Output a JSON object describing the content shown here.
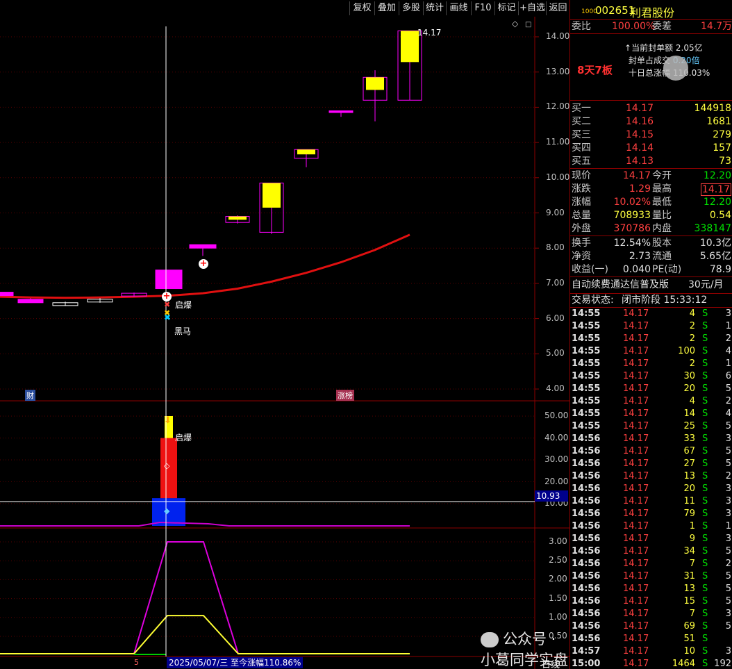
{
  "toolbar": {
    "buttons": [
      "复权",
      "叠加",
      "多股",
      "统计",
      "画线",
      "F10",
      "标记",
      "+自选",
      "返回"
    ]
  },
  "stock": {
    "code_prefix": "1000",
    "code": "002651",
    "name": "利君股份"
  },
  "weibi": {
    "label": "委比",
    "value": "100.00%",
    "diff_label": "委差",
    "diff_value": "14.7万"
  },
  "info": {
    "board": "8天7板",
    "seal_amount_label": "当前封单额",
    "seal_amount": "2.05亿",
    "seal_ratio_label": "封单占成交",
    "seal_ratio": "0.20倍",
    "ten_day_label": "十日总涨幅",
    "ten_day": "110.03%"
  },
  "bids": [
    {
      "label": "买一",
      "price": "14.17",
      "vol": "144918"
    },
    {
      "label": "买二",
      "price": "14.16",
      "vol": "1681"
    },
    {
      "label": "买三",
      "price": "14.15",
      "vol": "279"
    },
    {
      "label": "买四",
      "price": "14.14",
      "vol": "157"
    },
    {
      "label": "买五",
      "price": "14.13",
      "vol": "73"
    }
  ],
  "quote": [
    {
      "l1": "现价",
      "v1": "14.17",
      "c1": "red",
      "l2": "今开",
      "v2": "12.20",
      "c2": "green"
    },
    {
      "l1": "涨跌",
      "v1": "1.29",
      "c1": "red",
      "l2": "最高",
      "v2": "14.17",
      "c2": "red"
    },
    {
      "l1": "涨幅",
      "v1": "10.02%",
      "c1": "red",
      "l2": "最低",
      "v2": "12.20",
      "c2": "green"
    },
    {
      "l1": "总量",
      "v1": "708933",
      "c1": "yel",
      "l2": "量比",
      "v2": "0.54",
      "c2": "yel"
    },
    {
      "l1": "外盘",
      "v1": "370786",
      "c1": "red",
      "l2": "内盘",
      "v2": "338147",
      "c2": "green"
    }
  ],
  "finance": [
    {
      "l1": "换手",
      "v1": "12.54%",
      "l2": "股本",
      "v2": "10.3亿"
    },
    {
      "l1": "净资",
      "v1": "2.73",
      "l2": "流通",
      "v2": "5.65亿"
    },
    {
      "l1": "收益(一)",
      "v1": "0.040",
      "l2": "PE(动)",
      "v2": "78.9"
    }
  ],
  "promo": {
    "text": "自动续费通达信普及版",
    "price": "30元/月"
  },
  "status": {
    "label": "交易状态:",
    "value": "闭市阶段 15:33:12"
  },
  "ticks": [
    {
      "t": "14:55",
      "p": "14.17",
      "v": "4",
      "s": "S",
      "n": "3"
    },
    {
      "t": "14:55",
      "p": "14.17",
      "v": "2",
      "s": "S",
      "n": "1"
    },
    {
      "t": "14:55",
      "p": "14.17",
      "v": "2",
      "s": "S",
      "n": "2"
    },
    {
      "t": "14:55",
      "p": "14.17",
      "v": "100",
      "s": "S",
      "n": "4"
    },
    {
      "t": "14:55",
      "p": "14.17",
      "v": "2",
      "s": "S",
      "n": "1"
    },
    {
      "t": "14:55",
      "p": "14.17",
      "v": "30",
      "s": "S",
      "n": "6"
    },
    {
      "t": "14:55",
      "p": "14.17",
      "v": "20",
      "s": "S",
      "n": "5"
    },
    {
      "t": "14:55",
      "p": "14.17",
      "v": "4",
      "s": "S",
      "n": "2"
    },
    {
      "t": "14:55",
      "p": "14.17",
      "v": "14",
      "s": "S",
      "n": "4"
    },
    {
      "t": "14:55",
      "p": "14.17",
      "v": "25",
      "s": "S",
      "n": "5"
    },
    {
      "t": "14:56",
      "p": "14.17",
      "v": "33",
      "s": "S",
      "n": "3"
    },
    {
      "t": "14:56",
      "p": "14.17",
      "v": "67",
      "s": "S",
      "n": "5"
    },
    {
      "t": "14:56",
      "p": "14.17",
      "v": "27",
      "s": "S",
      "n": "5"
    },
    {
      "t": "14:56",
      "p": "14.17",
      "v": "13",
      "s": "S",
      "n": "2"
    },
    {
      "t": "14:56",
      "p": "14.17",
      "v": "20",
      "s": "S",
      "n": "3"
    },
    {
      "t": "14:56",
      "p": "14.17",
      "v": "11",
      "s": "S",
      "n": "3"
    },
    {
      "t": "14:56",
      "p": "14.17",
      "v": "79",
      "s": "S",
      "n": "3"
    },
    {
      "t": "14:56",
      "p": "14.17",
      "v": "1",
      "s": "S",
      "n": "1"
    },
    {
      "t": "14:56",
      "p": "14.17",
      "v": "9",
      "s": "S",
      "n": "3"
    },
    {
      "t": "14:56",
      "p": "14.17",
      "v": "34",
      "s": "S",
      "n": "5"
    },
    {
      "t": "14:56",
      "p": "14.17",
      "v": "7",
      "s": "S",
      "n": "2"
    },
    {
      "t": "14:56",
      "p": "14.17",
      "v": "31",
      "s": "S",
      "n": "5"
    },
    {
      "t": "14:56",
      "p": "14.17",
      "v": "13",
      "s": "S",
      "n": "5"
    },
    {
      "t": "14:56",
      "p": "14.17",
      "v": "15",
      "s": "S",
      "n": "5"
    },
    {
      "t": "14:56",
      "p": "14.17",
      "v": "7",
      "s": "S",
      "n": "3"
    },
    {
      "t": "14:56",
      "p": "14.17",
      "v": "69",
      "s": "S",
      "n": "5"
    },
    {
      "t": "14:56",
      "p": "14.17",
      "v": "51",
      "s": "S",
      "n": ""
    },
    {
      "t": "14:57",
      "p": "14.17",
      "v": "10",
      "s": "S",
      "n": "3"
    },
    {
      "t": "15:00",
      "p": "14.17",
      "v": "1464",
      "s": "S",
      "n": "192"
    }
  ],
  "watermark": {
    "text": "公众号 · 小葛同学实盘"
  },
  "chart": {
    "price_ticks": [
      "14.00",
      "13.00",
      "12.00",
      "11.00",
      "10.00",
      "9.00",
      "8.00",
      "7.00",
      "6.00",
      "5.00",
      "4.00"
    ],
    "last_price_label": "14.17",
    "signal_qibao": "启爆",
    "signal_heima": "黑马",
    "marker_cai": "财",
    "marker_zhangting": "涨榜",
    "vol_ticks": [
      "50.00",
      "40.00",
      "30.00",
      "20.00",
      "10.00"
    ],
    "vol_cursor_value": "10.93",
    "vol_signal": "启爆",
    "ind_ticks": [
      "3.00",
      "2.50",
      "2.00",
      "1.50",
      "1.00",
      "0.50"
    ],
    "bottom_left": "5",
    "bottom_info": "2025/05/07/三  至今涨幅110.86%",
    "period": "日线"
  },
  "chart_data": {
    "type": "candlestick",
    "ylim": [
      3.7,
      14.6
    ],
    "candles": [
      {
        "o": 6.75,
        "c": 6.65,
        "h": 6.75,
        "l": 6.65,
        "color": "#ff00ff",
        "fill": true
      },
      {
        "o": 6.55,
        "c": 6.45,
        "h": 6.58,
        "l": 6.45,
        "color": "#ff00ff",
        "fill": true
      },
      {
        "o": 6.45,
        "c": 6.37,
        "h": 6.48,
        "l": 6.36,
        "color": "#ffffff",
        "fill": false
      },
      {
        "o": 6.55,
        "c": 6.47,
        "h": 6.58,
        "l": 6.45,
        "color": "#ffffff",
        "fill": false
      },
      {
        "o": 6.72,
        "c": 6.64,
        "h": 6.74,
        "l": 6.62,
        "color": "#ff00ff",
        "fill": false
      },
      {
        "o": 7.38,
        "c": 6.85,
        "h": 7.38,
        "l": 6.85,
        "color": "#ff00ff",
        "fill": true
      },
      {
        "o": 8.1,
        "c": 8.0,
        "h": 8.1,
        "l": 7.78,
        "color": "#ff00ff",
        "fill": true
      },
      {
        "o": 8.9,
        "c": 8.73,
        "h": 8.93,
        "l": 8.7,
        "color": "#ff00ff",
        "fill": false,
        "body": "#ffff00"
      },
      {
        "o": 9.85,
        "c": 8.45,
        "h": 9.85,
        "l": 8.4,
        "color": "#ff00ff",
        "fill": false,
        "body": "#ffff00"
      },
      {
        "o": 10.8,
        "c": 10.55,
        "h": 10.8,
        "l": 10.3,
        "color": "#ff00ff",
        "fill": false,
        "body": "#ffff00"
      },
      {
        "o": 11.9,
        "c": 11.85,
        "h": 11.9,
        "l": 11.73,
        "color": "#ff00ff",
        "fill": true
      },
      {
        "o": 12.85,
        "c": 12.2,
        "h": 13.05,
        "l": 11.6,
        "color": "#ff00ff",
        "fill": false,
        "body": "#ffff00"
      },
      {
        "o": 14.17,
        "c": 12.2,
        "h": 14.17,
        "l": 12.2,
        "color": "#ff00ff",
        "fill": false,
        "body": "#ffff00"
      }
    ],
    "ma": [
      6.62,
      6.6,
      6.59,
      6.6,
      6.62,
      6.65,
      6.72,
      6.85,
      7.05,
      7.3,
      7.6,
      7.95,
      8.38
    ],
    "volume_bars": [
      {
        "x": "blue",
        "value": 12.5
      },
      {
        "x": "red",
        "value": 40
      },
      {
        "x": "yellow",
        "value": 50
      }
    ],
    "indicator_magenta": [
      0,
      0,
      0,
      0,
      0,
      3.0,
      3.0,
      0,
      0,
      0,
      0,
      0,
      0
    ],
    "indicator_yellow": [
      0,
      0,
      0,
      0,
      0,
      1.05,
      1.05,
      0,
      0,
      0,
      0,
      0,
      0
    ]
  }
}
